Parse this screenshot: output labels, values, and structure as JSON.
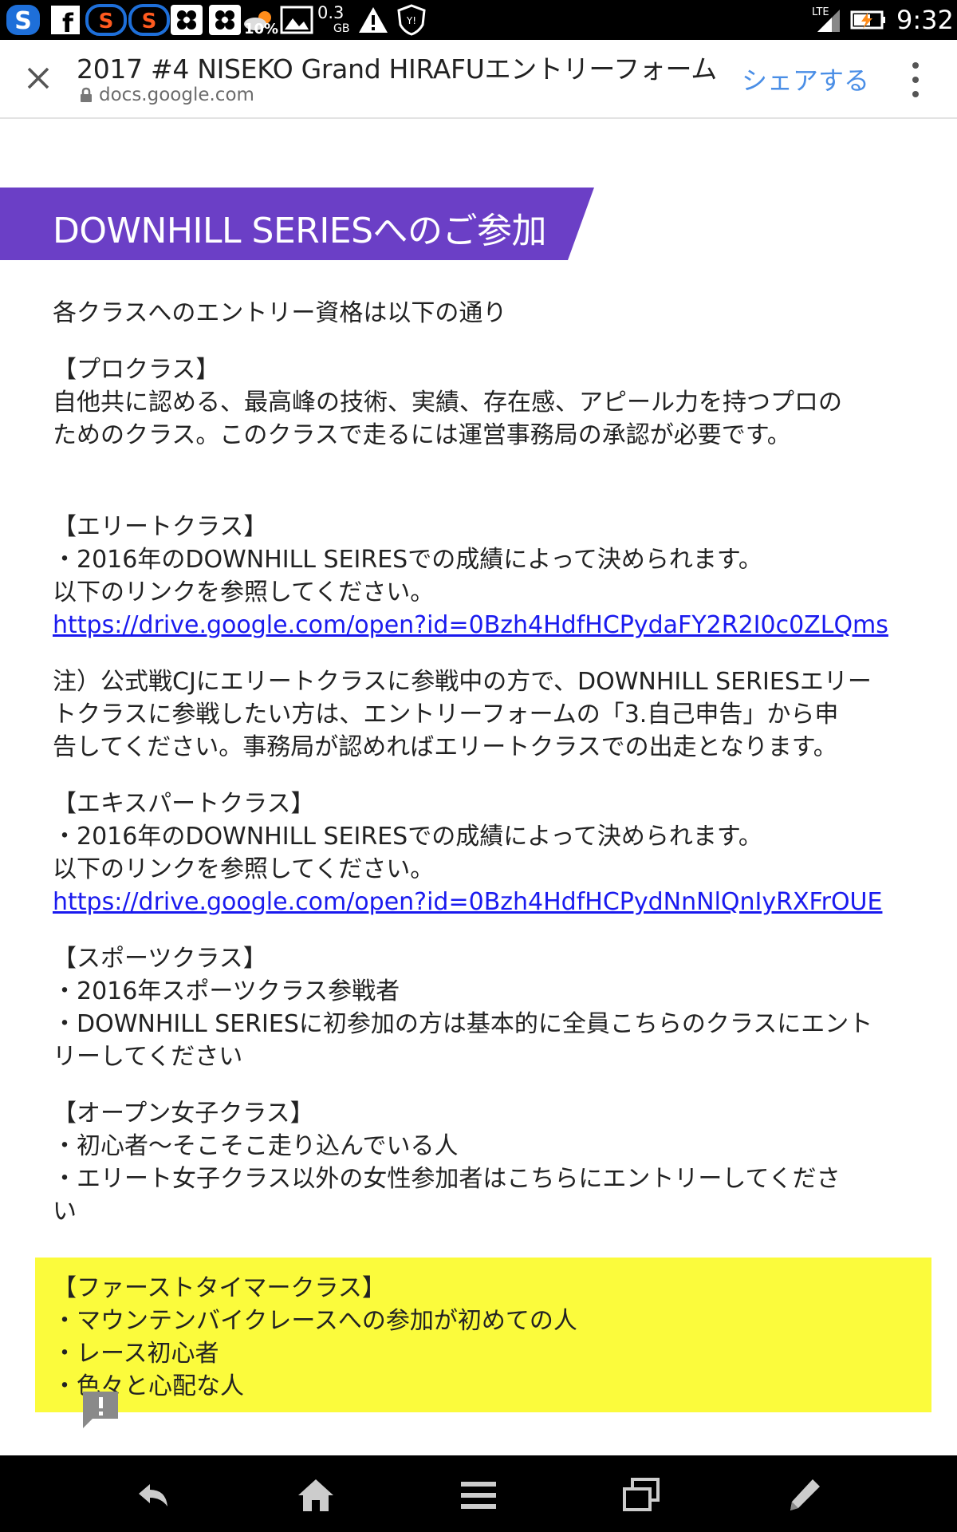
{
  "status_bar": {
    "icons": [
      "s-app-icon",
      "facebook-icon",
      "ss-app-icon",
      "ss-app-icon",
      "flower-app-icon",
      "flower-app-icon",
      "weather-icon",
      "gallery-icon",
      "data-usage-icon",
      "warning-icon",
      "shield-app-icon"
    ],
    "weather_percent": "10%",
    "data_amount": "0.3",
    "data_unit": "GB",
    "network": "LTE",
    "time": "9:32"
  },
  "header": {
    "title": "2017 #4 NISEKO Grand HIRAFUエントリーフォーム",
    "url": "docs.google.com",
    "share_label": "シェアする"
  },
  "section": {
    "banner_title": "DOWNHILL SERIESへのご参加",
    "banner_color": "#6b3fc6"
  },
  "content": {
    "intro": "各クラスへのエントリー資格は以下の通り",
    "pro": {
      "heading": "【プロクラス】",
      "line1": "自他共に認める、最高峰の技術、実績、存在感、アピール力を持つプロの",
      "line2": "ためのクラス。このクラスで走るには運営事務局の承認が必要です。"
    },
    "elite": {
      "heading": "【エリートクラス】",
      "line1": "・2016年のDOWNHILL SEIRESでの成績によって決められます。",
      "line2": "以下のリンクを参照してください。",
      "link": "https://drive.google.com/open?id=0Bzh4HdfHCPydaFY2R2I0c0ZLQms"
    },
    "note": {
      "line1": "注）公式戦CJにエリートクラスに参戦中の方で、DOWNHILL SERIESエリー",
      "line2": "トクラスに参戦したい方は、エントリーフォームの「3.自己申告」から申",
      "line3": "告してください。事務局が認めればエリートクラスでの出走となります。"
    },
    "expert": {
      "heading": "【エキスパートクラス】",
      "line1": "・2016年のDOWNHILL SEIRESでの成績によって決められます。",
      "line2": "以下のリンクを参照してください。",
      "link": "https://drive.google.com/open?id=0Bzh4HdfHCPydNnNlQnIyRXFrOUE"
    },
    "sports": {
      "heading": "【スポーツクラス】",
      "line1": "・2016年スポーツクラス参戦者",
      "line2": "・DOWNHILL SERIESに初参加の方は基本的に全員こちらのクラスにエント",
      "line3": "リーしてください"
    },
    "women": {
      "heading": "【オープン女子クラス】",
      "line1": "・初心者〜そこそこ走り込んでいる人",
      "line2": "・エリート女子クラス以外の女性参加者はこちらにエントリーしてくださ",
      "line3": "い"
    },
    "firsttimer": {
      "heading": "【ファーストタイマークラス】",
      "line1": "・マウンテンバイクレースへの参加が初めての人",
      "line2": "・レース初心者",
      "line3": "・色々と心配な人",
      "highlight_color": "#fbfb3c"
    }
  },
  "nav_bar": {
    "buttons": [
      "back-icon",
      "home-icon",
      "menu-icon",
      "recent-apps-icon",
      "edit-icon"
    ]
  }
}
